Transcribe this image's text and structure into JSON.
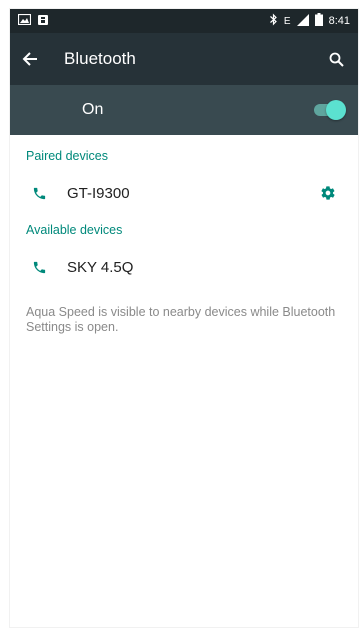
{
  "colors": {
    "accent": "#00897b",
    "appbar": "#263238",
    "toggle_bar": "#394a50",
    "statusbar": "#1e272b"
  },
  "status_bar": {
    "time": "8:41",
    "icons": [
      "image-icon",
      "notification-icon",
      "bluetooth-icon",
      "signal-e-icon",
      "signal-icon",
      "battery-icon"
    ]
  },
  "app_bar": {
    "title": "Bluetooth",
    "back_icon": "arrow-left-icon",
    "search_icon": "search-icon"
  },
  "toggle": {
    "label": "On",
    "state": true
  },
  "sections": {
    "paired": {
      "header": "Paired devices",
      "devices": [
        {
          "name": "GT-I9300",
          "icon": "phone-icon",
          "action_icon": "gear-icon"
        }
      ]
    },
    "available": {
      "header": "Available devices",
      "devices": [
        {
          "name": "SKY 4.5Q",
          "icon": "phone-icon"
        }
      ]
    }
  },
  "visibility_note": "Aqua Speed is visible to nearby devices while Bluetooth Settings is open."
}
